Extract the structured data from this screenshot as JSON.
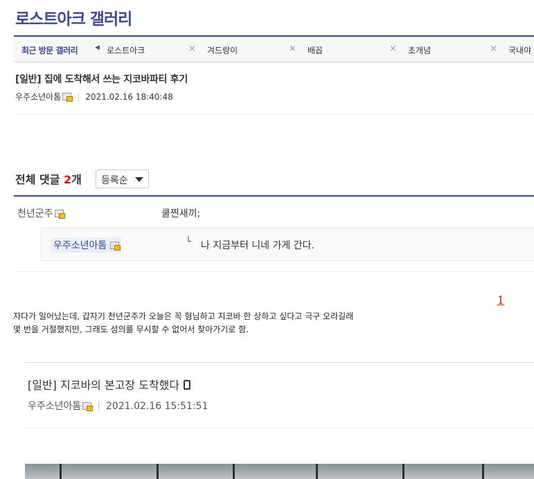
{
  "gallery": {
    "title": "로스트아크 갤러리"
  },
  "recent": {
    "label": "최근 방문 갤러리",
    "arrow": "◀",
    "close": "×",
    "items": [
      "로스트아크",
      "겨드랑이",
      "배꼽",
      "초개념",
      "국내야"
    ]
  },
  "post": {
    "title": "[일반] 집에 도착해서 쓰는 지코바파티 후기",
    "author": "우주소년아톰",
    "date": "2021.02.16 18:40:48"
  },
  "comments": {
    "head_label": "전체 댓글",
    "count": "2",
    "count_unit": "개",
    "sort": "등록순",
    "items": [
      {
        "author": "천년군주",
        "text": "쿨찐새끼;"
      }
    ],
    "reply": {
      "author": "우주소년아톰",
      "arrow": "└",
      "text": "나 지금부터 니네 가게 간다."
    }
  },
  "pagination": {
    "page": "1"
  },
  "body": {
    "line1": "자다가 일어났는데, 갑자기 천년군주가 오늘은 꼭 형님하고 지코바 한 상하고 싶다고 극구 오라길래",
    "line2": "몇 번을 거절했지만, 그래도 성의를 무시할 수 없어서 찾아가기로 함."
  },
  "quoted_post": {
    "title": "[일반] 지코바의 본고장 도착했다",
    "author": "우주소년아톰",
    "date": "2021.02.16 15:51:51"
  },
  "colors": {
    "accent": "#3b4890",
    "count_red": "#d31900"
  }
}
